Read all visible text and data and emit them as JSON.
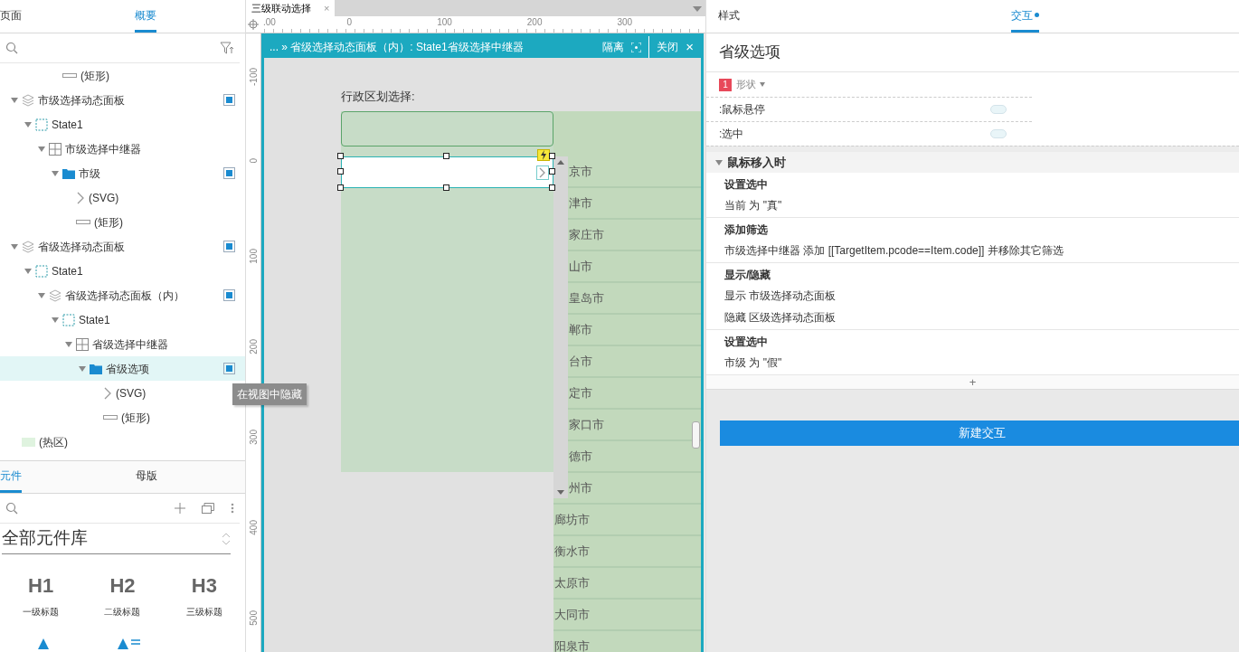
{
  "left_panel": {
    "tabs": [
      {
        "label": "页面",
        "selected": false
      },
      {
        "label": "概要",
        "selected": true
      }
    ],
    "outline": {
      "scrolled_leaf": {
        "label": "(矩形)",
        "kind": "rectangle"
      },
      "tree": [
        {
          "label": "市级选择动态面板",
          "kind": "dynamic_panel",
          "expanded": true,
          "selected": false,
          "view_toggle": true,
          "children": [
            {
              "label": "State1",
              "kind": "state",
              "expanded": true,
              "selected": false,
              "view_toggle": false,
              "children": [
                {
                  "label": "市级选择中继器",
                  "kind": "repeater",
                  "expanded": true,
                  "selected": false,
                  "view_toggle": false,
                  "children": [
                    {
                      "label": "市级",
                      "kind": "folder",
                      "expanded": true,
                      "selected": false,
                      "view_toggle": true,
                      "children": [
                        {
                          "label": "(SVG)",
                          "kind": "svg",
                          "selected": false,
                          "view_toggle": false
                        },
                        {
                          "label": "(矩形)",
                          "kind": "rectangle",
                          "selected": false,
                          "view_toggle": false
                        }
                      ]
                    }
                  ]
                }
              ]
            }
          ]
        },
        {
          "label": "省级选择动态面板",
          "kind": "dynamic_panel",
          "expanded": true,
          "selected": false,
          "view_toggle": true,
          "children": [
            {
              "label": "State1",
              "kind": "state",
              "expanded": true,
              "selected": false,
              "view_toggle": false,
              "children": [
                {
                  "label": "省级选择动态面板（内）",
                  "kind": "dynamic_panel",
                  "expanded": true,
                  "selected": false,
                  "view_toggle": true,
                  "children": [
                    {
                      "label": "State1",
                      "kind": "state",
                      "expanded": true,
                      "selected": false,
                      "view_toggle": false,
                      "children": [
                        {
                          "label": "省级选择中继器",
                          "kind": "repeater",
                          "expanded": true,
                          "selected": false,
                          "view_toggle": false,
                          "children": [
                            {
                              "label": "省级选项",
                              "kind": "folder",
                              "expanded": true,
                              "selected": true,
                              "view_toggle": true,
                              "children": [
                                {
                                  "label": "(SVG)",
                                  "kind": "svg",
                                  "selected": false,
                                  "view_toggle": false
                                },
                                {
                                  "label": "(矩形)",
                                  "kind": "rectangle",
                                  "selected": false,
                                  "view_toggle": false
                                }
                              ]
                            }
                          ]
                        }
                      ]
                    }
                  ]
                }
              ]
            }
          ]
        },
        {
          "label": "(热区)",
          "kind": "hotspot",
          "selected": false,
          "view_toggle": false
        }
      ]
    },
    "tooltip": "在视图中隐藏",
    "library": {
      "tabs": [
        {
          "label": "元件",
          "selected": true
        },
        {
          "label": "母版",
          "selected": false
        }
      ],
      "library_select": "全部元件库",
      "widgets": [
        {
          "glyph": "H1",
          "label": "一级标题"
        },
        {
          "glyph": "H2",
          "label": "二级标题"
        },
        {
          "glyph": "H3",
          "label": "三级标题"
        }
      ],
      "more_widgets": [
        {
          "kind": "text"
        },
        {
          "kind": "paragraph"
        }
      ]
    }
  },
  "canvas": {
    "doc_tab": {
      "label": "三级联动选择",
      "close": "×",
      "selected": true
    },
    "ruler": {
      "h_labels": [
        ".00",
        "0",
        "100",
        "200",
        "300"
      ],
      "v_labels": [
        "-100",
        "0",
        "100",
        "200",
        "300",
        "400",
        "500"
      ]
    },
    "edit_frame": {
      "breadcrumb": "... » 省级选择动态面板（内）: State1省级选择中继器",
      "isolate": "隔离",
      "close": "关闭",
      "close_glyph": "×"
    },
    "form_label": "行政区划选择:",
    "city_list": [
      "京市",
      "津市",
      "家庄市",
      "山市",
      "皇岛市",
      "郸市",
      "台市",
      "定市",
      "家口市",
      "德市",
      "州市",
      "廊坊市",
      "衡水市",
      "太原市",
      "大同市",
      "阳泉市"
    ]
  },
  "right_panel": {
    "tabs": [
      {
        "label": "样式",
        "selected": false,
        "dot": false
      },
      {
        "label": "交互",
        "selected": true,
        "dot": true
      }
    ],
    "widget_name": "省级选项",
    "shape_menu": {
      "count": "1",
      "label": "形状"
    },
    "states": [
      {
        "label": ":鼠标悬停",
        "on": false
      },
      {
        "label": ":选中",
        "on": false
      }
    ],
    "event": {
      "title": "鼠标移入时",
      "expanded": true,
      "actions": [
        {
          "title": "设置选中",
          "lines": [
            "当前 为 \"真\""
          ]
        },
        {
          "title": "添加筛选",
          "lines": [
            "市级选择中继器 添加 [[TargetItem.pcode==Item.code]] 并移除其它筛选"
          ]
        },
        {
          "title": "显示/隐藏",
          "lines": [
            "显示 市级选择动态面板",
            "隐藏 区级选择动态面板"
          ]
        },
        {
          "title": "设置选中",
          "lines": [
            "市级 为 \"假\""
          ]
        }
      ]
    },
    "add_glyph": "+",
    "new_button": "新建交互"
  }
}
